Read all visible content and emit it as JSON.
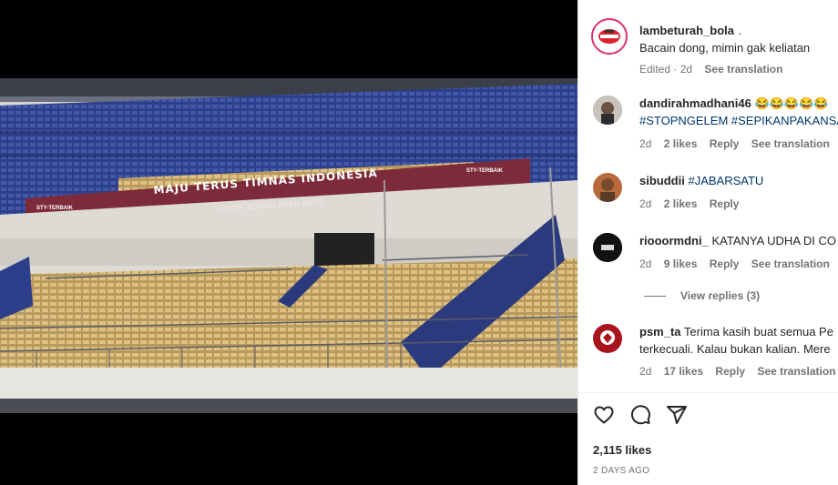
{
  "post": {
    "username": "lambeturah_bola",
    "username_suffix": ".",
    "caption": "Bacain dong, mimin gak keliatan",
    "edited": "Edited",
    "time": "2d",
    "see_translation": "See translation",
    "banner_main": "MAJU TERUS TIMNAS INDONESIA",
    "banner_sub": "HATUR NUHUN IWAN BULE",
    "banner_left": "STY-TERBAIK",
    "banner_right": "STY-TERBAIK"
  },
  "comments": [
    {
      "username": "dandirahmadhani46",
      "text": "😂😂😂😂😂",
      "text2": "#STOPNGELEM #SEPIKANPAKANSA",
      "time": "2d",
      "likes": "2 likes",
      "reply": "Reply",
      "translate": "See translation"
    },
    {
      "username": "sibuddii",
      "text": "#JABARSATU",
      "time": "2d",
      "likes": "2 likes",
      "reply": "Reply"
    },
    {
      "username": "riooormdni_",
      "text": "KATANYA UDHA DI CO",
      "time": "2d",
      "likes": "9 likes",
      "reply": "Reply",
      "translate": "See translation",
      "view_replies": "View replies (3)"
    },
    {
      "username": "psm_ta",
      "text": "Terima kasih buat semua Pe",
      "text2": "terkecuali. Kalau bukan kalian. Mere",
      "time": "2d",
      "likes": "17 likes",
      "reply": "Reply",
      "translate": "See translation"
    }
  ],
  "likes_count": "2,115 likes",
  "post_date": "2 DAYS AGO",
  "icons": [
    "heart-icon",
    "comment-icon",
    "share-icon"
  ],
  "colors": {
    "link": "#00376b",
    "muted": "#737373",
    "story_ring": "#e1306c"
  }
}
